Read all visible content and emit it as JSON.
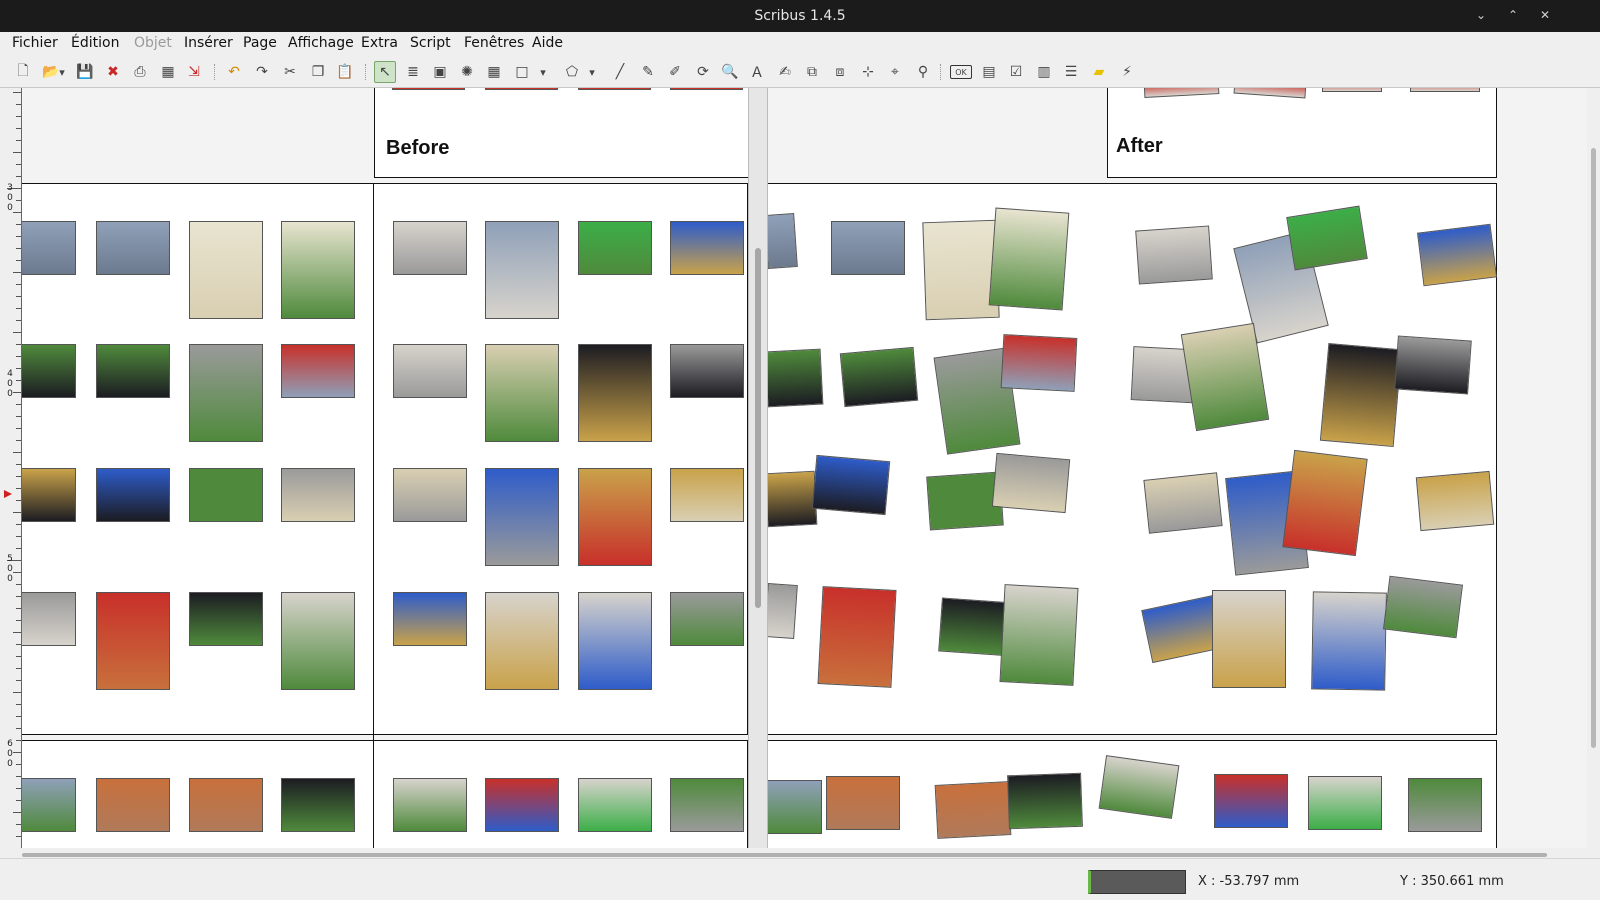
{
  "window": {
    "title": "Scribus 1.4.5"
  },
  "menus": [
    {
      "label": "Fichier",
      "disabled": false
    },
    {
      "label": "Édition",
      "disabled": false
    },
    {
      "label": "Objet",
      "disabled": true
    },
    {
      "label": "Insérer",
      "disabled": false
    },
    {
      "label": "Page",
      "disabled": false
    },
    {
      "label": "Affichage",
      "disabled": false
    },
    {
      "label": "Extra",
      "disabled": false
    },
    {
      "label": "Script",
      "disabled": false
    },
    {
      "label": "Fenêtres",
      "disabled": false
    },
    {
      "label": "Aide",
      "disabled": false
    }
  ],
  "toolbar": {
    "icons": [
      "new-document-icon",
      "open-icon",
      "open-recent-dropdown-icon",
      "save-icon",
      "close-document-icon",
      "print-icon",
      "preflight-icon",
      "export-pdf-icon",
      "undo-icon",
      "redo-icon",
      "cut-icon",
      "copy-icon",
      "paste-icon",
      "select-icon",
      "text-frame-icon",
      "image-frame-icon",
      "render-frame-icon",
      "table-icon",
      "shape-icon",
      "shape-dropdown-icon",
      "polygon-icon",
      "polygon-dropdown-icon",
      "line-icon",
      "bezier-icon",
      "freehand-icon",
      "rotate-icon",
      "zoom-icon",
      "edit-contents-icon",
      "edit-text-icon",
      "link-frames-icon",
      "unlink-frames-icon",
      "measurements-icon",
      "copy-properties-icon",
      "eyedropper-icon",
      "pdf-push-button-icon",
      "pdf-text-field-icon",
      "pdf-checkbox-icon",
      "pdf-combo-box-icon",
      "pdf-list-box-icon",
      "text-annotation-icon",
      "link-annotation-icon"
    ]
  },
  "ruler": {
    "labels": [
      "300",
      "400",
      "500",
      "600"
    ]
  },
  "canvas": {
    "before_label": "Before",
    "after_label": "After"
  },
  "palette": {
    "sky": "#8fa0b8",
    "water": "#6c7a8e",
    "menu_paper": "#e8e4d0",
    "green": "#4f8a3c",
    "bright_green": "#3cae48",
    "temple_gold": "#c9a24a",
    "sky_blue": "#2e5cc9",
    "dark": "#1c1c22",
    "skin": "#b07a5a",
    "grey": "#9a9a9a",
    "wall": "#d7d3cc",
    "warm": "#c8703c",
    "red": "#c8302a",
    "cream": "#d9cfb2"
  },
  "statusbar": {
    "x_label": "X :  -53.797 mm",
    "y_label": "Y :  350.661 mm"
  }
}
